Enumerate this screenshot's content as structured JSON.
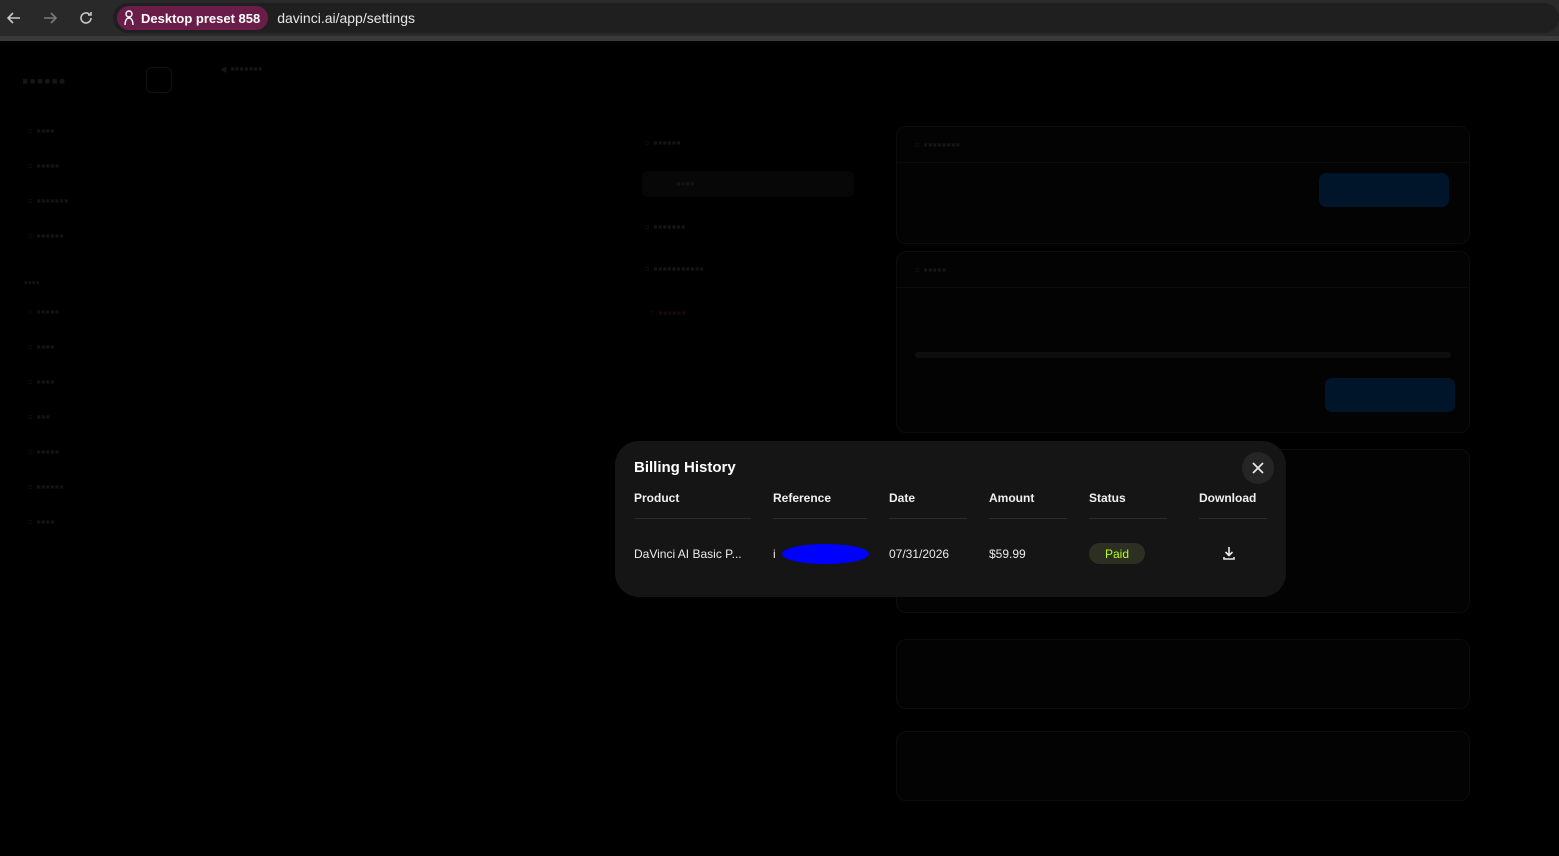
{
  "browser": {
    "profile_label": "Desktop preset 858",
    "url": "davinci.ai/app/settings"
  },
  "modal": {
    "title": "Billing History",
    "columns": [
      "Product",
      "Reference",
      "Date",
      "Amount",
      "Status",
      "Download"
    ],
    "rows": [
      {
        "product": "DaVinci AI Basic P...",
        "reference_prefix": "i",
        "date": "07/31/2026",
        "amount": "$59.99",
        "status": "Paid"
      }
    ],
    "icons": {
      "close": "close-icon",
      "download": "download-icon"
    },
    "colors": {
      "status_paid_text": "#b5ff1b",
      "status_paid_bg": "#2c2f22",
      "redaction": "#0000ff"
    }
  }
}
